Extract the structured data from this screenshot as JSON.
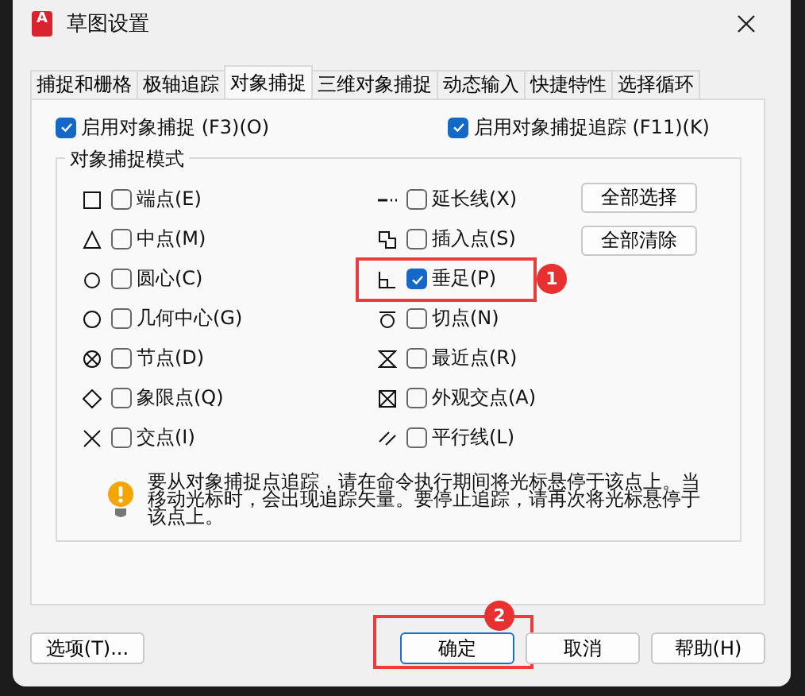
{
  "window": {
    "title": "草图设置",
    "logo": "A"
  },
  "tabs": [
    {
      "label": "捕捉和栅格",
      "selected": false
    },
    {
      "label": "极轴追踪",
      "selected": false
    },
    {
      "label": "对象捕捉",
      "selected": true
    },
    {
      "label": "三维对象捕捉",
      "selected": false
    },
    {
      "label": "动态输入",
      "selected": false
    },
    {
      "label": "快捷特性",
      "selected": false
    },
    {
      "label": "选择循环",
      "selected": false
    }
  ],
  "enable_snap": {
    "label": "启用对象捕捉 (F3)(O)",
    "checked": true
  },
  "enable_tracking": {
    "label": "启用对象捕捉追踪 (F11)(K)",
    "checked": true
  },
  "snap_modes": {
    "title": "对象捕捉模式",
    "left_column": [
      {
        "label": "端点(E)",
        "checked": false,
        "highlighted": false
      },
      {
        "label": "中点(M)",
        "checked": false,
        "highlighted": false
      },
      {
        "label": "圆心(C)",
        "checked": false,
        "highlighted": false
      },
      {
        "label": "几何中心(G)",
        "checked": false,
        "highlighted": false
      },
      {
        "label": "节点(D)",
        "checked": false,
        "highlighted": false
      },
      {
        "label": "象限点(Q)",
        "checked": false,
        "highlighted": false
      },
      {
        "label": "交点(I)",
        "checked": false,
        "highlighted": false
      }
    ],
    "right_column": [
      {
        "label": "延长线(X)",
        "checked": false,
        "highlighted": false
      },
      {
        "label": "插入点(S)",
        "checked": false,
        "highlighted": false
      },
      {
        "label": "垂足(P)",
        "checked": true,
        "highlighted": true,
        "callout": "1"
      },
      {
        "label": "切点(N)",
        "checked": false,
        "highlighted": false
      },
      {
        "label": "最近点(R)",
        "checked": false,
        "highlighted": false
      },
      {
        "label": "外观交点(A)",
        "checked": false,
        "highlighted": false
      },
      {
        "label": "平行线(L)",
        "checked": false,
        "highlighted": false
      }
    ],
    "select_all": "全部选择",
    "clear_all": "全部清除"
  },
  "hint": "要从对象捕捉点追踪，请在命令执行期间将光标悬停于该点上。当移动光标时，会出现追踪矢量。要停止追踪，请再次将光标悬停于该点上。",
  "footer": {
    "options": "选项(T)...",
    "buttons": [
      {
        "label": "确定",
        "kind": "default",
        "highlighted": true,
        "callout": "2"
      },
      {
        "label": "取消",
        "kind": "normal",
        "highlighted": false
      },
      {
        "label": "帮助(H)",
        "kind": "normal",
        "highlighted": false
      }
    ]
  }
}
